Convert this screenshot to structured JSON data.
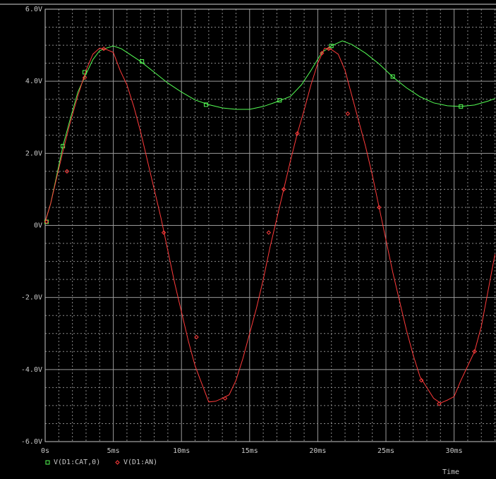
{
  "chart_data": {
    "type": "line",
    "x_label": "Time",
    "x_unit": "ms",
    "xlim": [
      0,
      33
    ],
    "ylim": [
      -6,
      6
    ],
    "x_ticks": [
      {
        "v": 0,
        "label": "0s"
      },
      {
        "v": 5,
        "label": "5ms"
      },
      {
        "v": 10,
        "label": "10ms"
      },
      {
        "v": 15,
        "label": "15ms"
      },
      {
        "v": 20,
        "label": "20ms"
      },
      {
        "v": 25,
        "label": "25ms"
      },
      {
        "v": 30,
        "label": "30ms"
      }
    ],
    "y_ticks": [
      {
        "v": 6,
        "label": "6.0V"
      },
      {
        "v": 4,
        "label": "4.0V"
      },
      {
        "v": 2,
        "label": "2.0V"
      },
      {
        "v": 0,
        "label": "0V"
      },
      {
        "v": -2,
        "label": "-2.0V"
      },
      {
        "v": -4,
        "label": "-4.0V"
      },
      {
        "v": -6,
        "label": "-6.0V"
      }
    ],
    "grid": true,
    "legend_position": "bottom-left",
    "series": [
      {
        "name": "V(D1:CAT,0)",
        "color": "#55ff55",
        "marker": "square",
        "points": [
          [
            0,
            0.1
          ],
          [
            0.4,
            0.6
          ],
          [
            0.8,
            1.3
          ],
          [
            1.3,
            2.2
          ],
          [
            1.8,
            2.9
          ],
          [
            2.4,
            3.7
          ],
          [
            3.0,
            4.2
          ],
          [
            3.5,
            4.6
          ],
          [
            4.0,
            4.85
          ],
          [
            4.5,
            4.92
          ],
          [
            5.0,
            4.98
          ],
          [
            5.6,
            4.9
          ],
          [
            6.2,
            4.75
          ],
          [
            7.0,
            4.55
          ],
          [
            8.0,
            4.25
          ],
          [
            9.0,
            3.95
          ],
          [
            10.0,
            3.7
          ],
          [
            11.0,
            3.48
          ],
          [
            12.0,
            3.35
          ],
          [
            13.0,
            3.26
          ],
          [
            14.0,
            3.22
          ],
          [
            15.0,
            3.22
          ],
          [
            16.0,
            3.3
          ],
          [
            17.0,
            3.43
          ],
          [
            18.0,
            3.58
          ],
          [
            18.8,
            3.9
          ],
          [
            19.5,
            4.3
          ],
          [
            20.3,
            4.8
          ],
          [
            21.0,
            4.98
          ],
          [
            21.8,
            5.12
          ],
          [
            22.5,
            5.02
          ],
          [
            23.5,
            4.78
          ],
          [
            24.5,
            4.48
          ],
          [
            25.5,
            4.12
          ],
          [
            26.5,
            3.82
          ],
          [
            27.5,
            3.57
          ],
          [
            28.5,
            3.4
          ],
          [
            29.5,
            3.32
          ],
          [
            30.5,
            3.3
          ],
          [
            31.5,
            3.34
          ],
          [
            32.5,
            3.45
          ],
          [
            33.0,
            3.52
          ]
        ],
        "marker_points": [
          [
            0.1,
            0.1
          ],
          [
            1.3,
            2.2
          ],
          [
            2.9,
            4.25
          ],
          [
            7.1,
            4.55
          ],
          [
            11.8,
            3.35
          ],
          [
            17.2,
            3.47
          ],
          [
            21.0,
            4.98
          ],
          [
            25.5,
            4.13
          ],
          [
            30.5,
            3.3
          ]
        ]
      },
      {
        "name": "V(D1:AN)",
        "color": "#ff3b3b",
        "marker": "diamond",
        "points": [
          [
            0,
            0.1
          ],
          [
            0.4,
            0.6
          ],
          [
            0.8,
            1.25
          ],
          [
            1.3,
            2.05
          ],
          [
            1.8,
            2.8
          ],
          [
            2.4,
            3.6
          ],
          [
            3.0,
            4.3
          ],
          [
            3.5,
            4.75
          ],
          [
            4.0,
            4.92
          ],
          [
            4.5,
            4.88
          ],
          [
            5.0,
            4.8
          ],
          [
            5.5,
            4.3
          ],
          [
            6.0,
            3.9
          ],
          [
            6.5,
            3.3
          ],
          [
            7.0,
            2.6
          ],
          [
            7.5,
            1.8
          ],
          [
            8.0,
            1.0
          ],
          [
            8.5,
            0.2
          ],
          [
            9.0,
            -0.7
          ],
          [
            9.5,
            -1.6
          ],
          [
            10.0,
            -2.4
          ],
          [
            10.5,
            -3.2
          ],
          [
            11.0,
            -3.9
          ],
          [
            11.5,
            -4.4
          ],
          [
            12.0,
            -4.9
          ],
          [
            12.5,
            -4.88
          ],
          [
            13.0,
            -4.8
          ],
          [
            13.5,
            -4.7
          ],
          [
            14.0,
            -4.3
          ],
          [
            14.5,
            -3.7
          ],
          [
            15.0,
            -3.0
          ],
          [
            15.5,
            -2.3
          ],
          [
            16.0,
            -1.5
          ],
          [
            16.5,
            -0.6
          ],
          [
            17.0,
            0.2
          ],
          [
            17.5,
            1.0
          ],
          [
            18.0,
            1.8
          ],
          [
            18.5,
            2.55
          ],
          [
            19.0,
            3.2
          ],
          [
            19.5,
            3.9
          ],
          [
            20.0,
            4.5
          ],
          [
            20.5,
            4.92
          ],
          [
            21.0,
            4.88
          ],
          [
            21.5,
            4.75
          ],
          [
            22.0,
            4.3
          ],
          [
            22.5,
            3.6
          ],
          [
            23.0,
            2.9
          ],
          [
            23.5,
            2.2
          ],
          [
            24.0,
            1.4
          ],
          [
            24.5,
            0.5
          ],
          [
            25.0,
            -0.4
          ],
          [
            25.5,
            -1.3
          ],
          [
            26.0,
            -2.1
          ],
          [
            26.5,
            -2.9
          ],
          [
            27.0,
            -3.6
          ],
          [
            27.5,
            -4.2
          ],
          [
            28.0,
            -4.5
          ],
          [
            28.5,
            -4.8
          ],
          [
            29.0,
            -4.93
          ],
          [
            29.5,
            -4.85
          ],
          [
            30.0,
            -4.75
          ],
          [
            30.5,
            -4.3
          ],
          [
            31.0,
            -3.9
          ],
          [
            31.5,
            -3.5
          ],
          [
            32.0,
            -2.8
          ],
          [
            32.5,
            -1.8
          ],
          [
            33.0,
            -0.8
          ]
        ],
        "marker_points": [
          [
            0.1,
            0.1
          ],
          [
            1.6,
            1.5
          ],
          [
            2.9,
            4.1
          ],
          [
            4.3,
            4.9
          ],
          [
            8.7,
            -0.2
          ],
          [
            11.1,
            -3.1
          ],
          [
            13.2,
            -4.8
          ],
          [
            16.4,
            -0.2
          ],
          [
            17.5,
            1.0
          ],
          [
            18.5,
            2.55
          ],
          [
            20.3,
            4.78
          ],
          [
            20.8,
            4.9
          ],
          [
            22.2,
            3.1
          ],
          [
            24.5,
            0.5
          ],
          [
            27.6,
            -4.3
          ],
          [
            28.9,
            -4.95
          ],
          [
            31.5,
            -3.5
          ]
        ]
      }
    ]
  }
}
